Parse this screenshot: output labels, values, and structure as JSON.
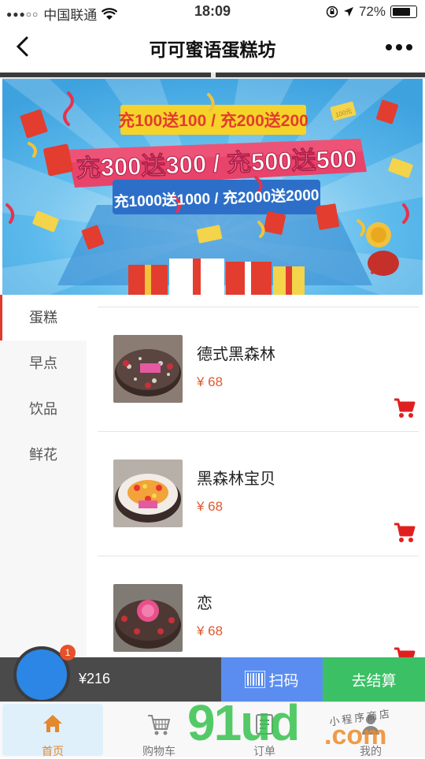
{
  "status_bar": {
    "carrier": "中国联通",
    "time": "18:09",
    "battery": "72%"
  },
  "nav": {
    "title": "可可蜜语蛋糕坊"
  },
  "banner": {
    "line1": "充100送100 / 充200送200",
    "line2": "充300送300 / 充500送500",
    "line3": "充1000送1000 / 充2000送2000",
    "tag": "100元"
  },
  "categories": [
    {
      "label": "蛋糕",
      "active": true
    },
    {
      "label": "早点",
      "active": false
    },
    {
      "label": "饮品",
      "active": false
    },
    {
      "label": "鲜花",
      "active": false
    }
  ],
  "products": [
    {
      "name": "德式黑森林",
      "price": "¥ 68"
    },
    {
      "name": "黑森林宝贝",
      "price": "¥ 68"
    },
    {
      "name": "恋",
      "price": "¥ 68"
    }
  ],
  "cart_bar": {
    "badge": "1",
    "total": "¥216",
    "scan_label": "扫码",
    "checkout_label": "去结算"
  },
  "tabs": [
    {
      "label": "首页",
      "active": true
    },
    {
      "label": "购物车",
      "active": false
    },
    {
      "label": "订单",
      "active": false
    },
    {
      "label": "我的",
      "active": false
    }
  ],
  "watermark": {
    "text": "91ud",
    "dotcom": ".com",
    "tag": "小程序商店"
  },
  "colors": {
    "accent_red": "#e03b2d",
    "price_orange": "#e0572d",
    "scan_blue": "#5b8df0",
    "checkout_green": "#3cc066",
    "cart_blue": "#2b86e6"
  }
}
